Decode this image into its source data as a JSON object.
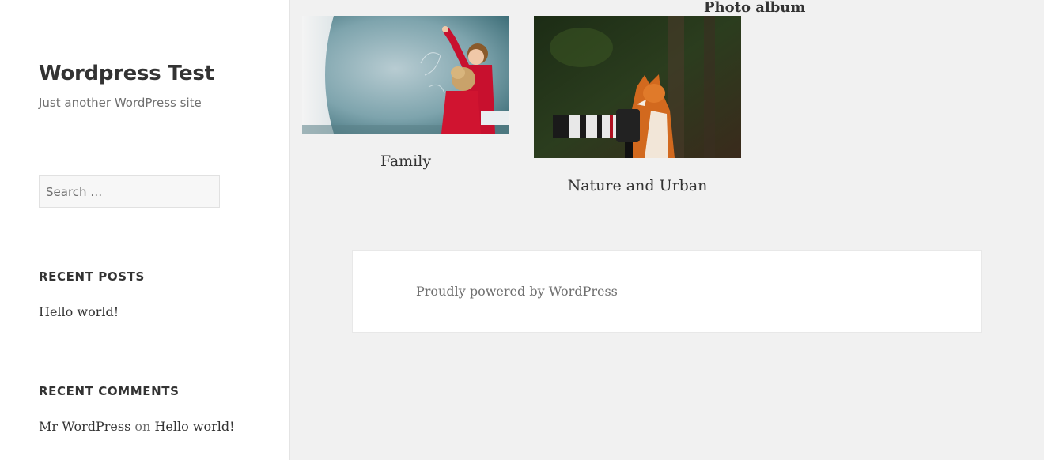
{
  "site": {
    "title": "Wordpress Test",
    "description": "Just another WordPress site"
  },
  "search": {
    "placeholder": "Search …",
    "value": ""
  },
  "widgets": {
    "recent_posts": {
      "title": "RECENT POSTS",
      "items": [
        "Hello world!"
      ]
    },
    "recent_comments": {
      "title": "RECENT COMMENTS",
      "author": "Mr WordPress",
      "connector": "on",
      "post": "Hello world!"
    }
  },
  "album": {
    "heading": "Photo album",
    "items": [
      {
        "caption": "Family",
        "image": "children-drawing-on-chalkboard"
      },
      {
        "caption": "Nature and Urban",
        "image": "fox-with-camera"
      }
    ]
  },
  "footer": {
    "credit": "Proudly powered by WordPress"
  },
  "colors": {
    "page_background": "#f1f1f1",
    "sidebar_background": "#ffffff",
    "text": "#333333",
    "muted_text": "#707070"
  }
}
